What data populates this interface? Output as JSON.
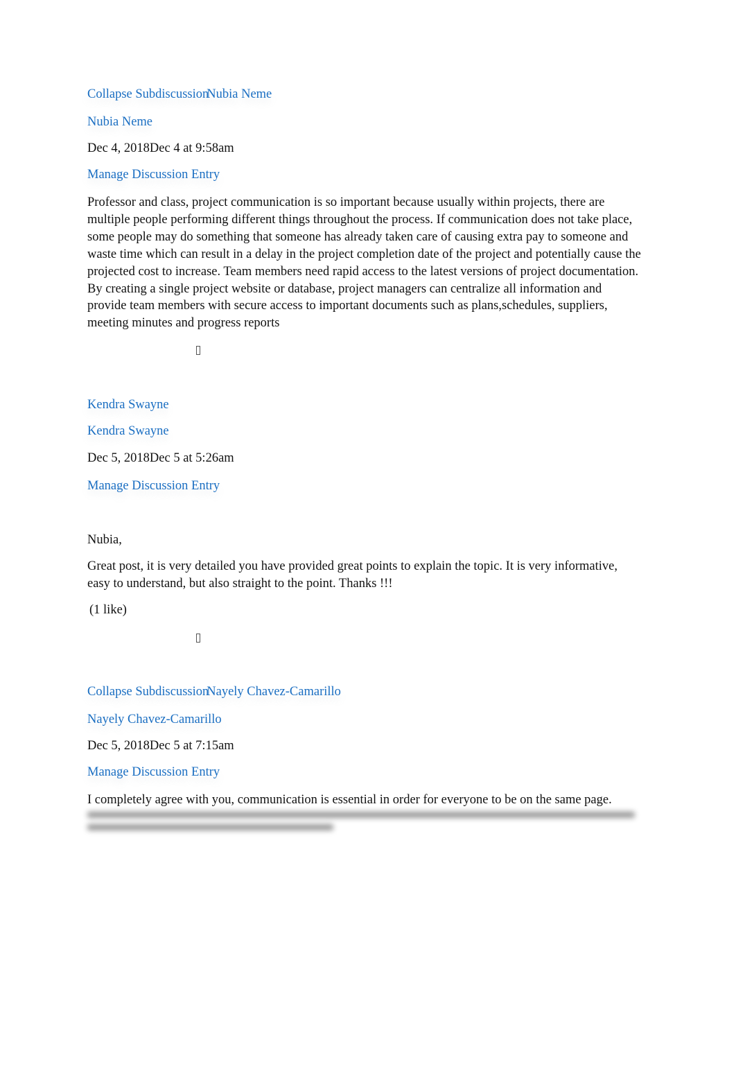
{
  "entries": [
    {
      "collapse_label": "Collapse Subdiscussion",
      "collapse_author": "Nubia Neme",
      "author": "Nubia Neme",
      "date": "Dec 4, 2018",
      "date_detail": "Dec 4 at 9:58am",
      "manage_label": "Manage Discussion Entry",
      "body": "Professor and class, project communication is so important because usually within projects, there are multiple people performing different things throughout the process. If communication does not take place, some people may do something that someone has already taken care of causing extra pay to someone and waste time which can result in a delay in the project completion date of the project and potentially cause the projected cost to increase. Team members need rapid access to the latest versions of project documentation. By creating a single project website or database, project managers can centralize all information and provide team members with secure access to important documents such as plans,schedules, suppliers, meeting minutes and progress reports",
      "icon": "missing-glyph-icon"
    },
    {
      "header_author": "Kendra Swayne",
      "author": "Kendra Swayne",
      "date": "Dec 5, 2018",
      "date_detail": "Dec 5 at 5:26am",
      "manage_label": "Manage Discussion Entry",
      "greeting": "Nubia,",
      "body": "Great post, it is very detailed you have provided great points to explain the topic. It is very informative, easy to understand, but also straight to the point. Thanks !!!",
      "likes": "(1 like)",
      "icon": "missing-glyph-icon"
    },
    {
      "collapse_label": "Collapse Subdiscussion",
      "collapse_author": "Nayely Chavez-Camarillo",
      "author": "Nayely Chavez-Camarillo",
      "date": "Dec 5, 2018",
      "date_detail": "Dec 5 at 7:15am",
      "manage_label": "Manage Discussion Entry",
      "body_visible": "I completely agree with you, communication is essential in order for everyone to be on the same page."
    }
  ]
}
